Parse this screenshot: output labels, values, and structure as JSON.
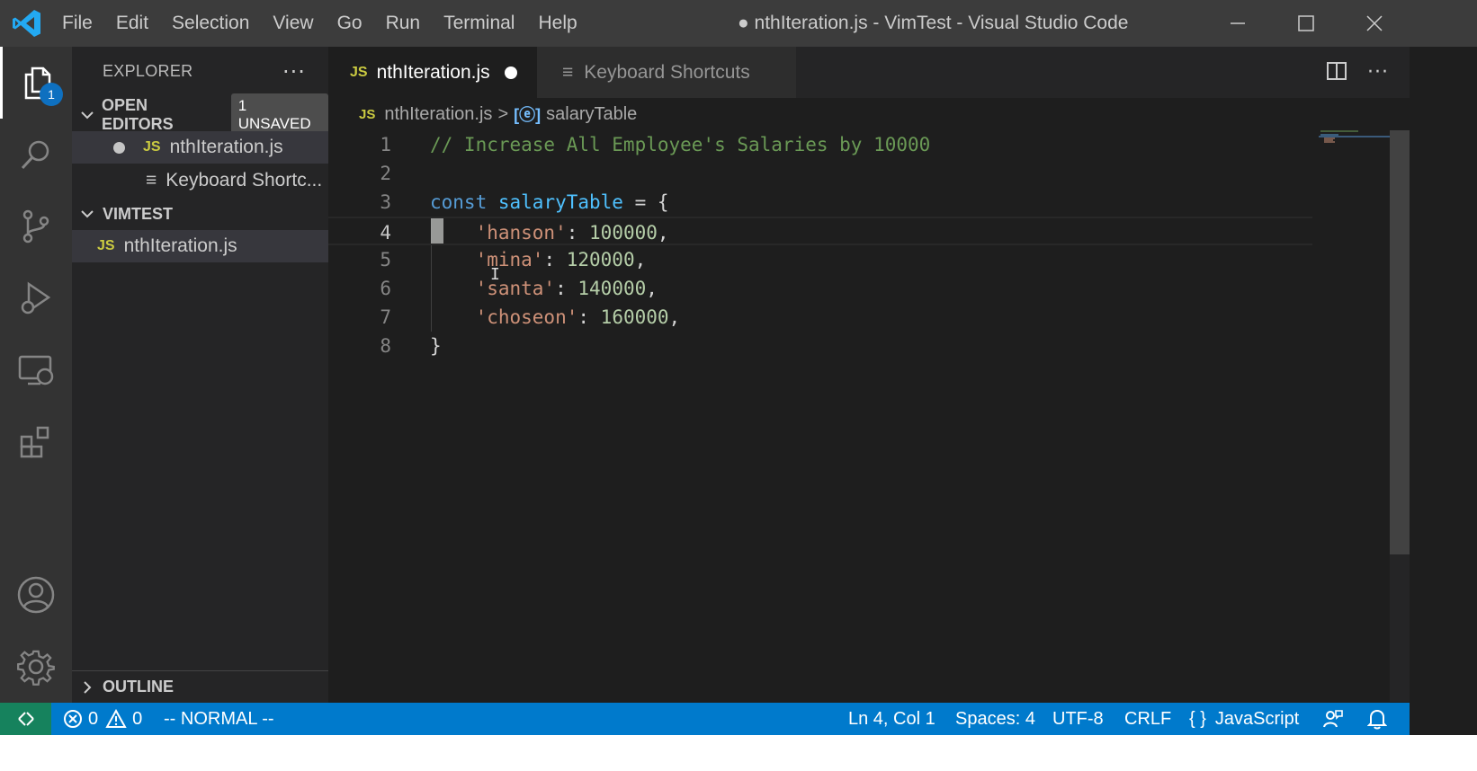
{
  "titlebar": {
    "menu": [
      "File",
      "Edit",
      "Selection",
      "View",
      "Go",
      "Run",
      "Terminal",
      "Help"
    ],
    "window_title": "● nthIteration.js - VimTest - Visual Studio Code"
  },
  "activitybar": {
    "explorer_badge": "1",
    "icons": [
      "files-icon",
      "search-icon",
      "source-control-icon",
      "run-debug-icon",
      "remote-explorer-icon",
      "extensions-icon",
      "accounts-icon",
      "settings-gear-icon"
    ]
  },
  "sidebar": {
    "title": "EXPLORER",
    "more": "···",
    "open_editors": {
      "label": "OPEN EDITORS",
      "badge": "1 UNSAVED",
      "items": [
        {
          "icon": "JS",
          "label": "nthIteration.js"
        },
        {
          "icon": "≡",
          "label": "Keyboard Shortc..."
        }
      ]
    },
    "workspace": {
      "label": "VIMTEST",
      "items": [
        {
          "icon": "JS",
          "label": "nthIteration.js"
        }
      ]
    },
    "outline_label": "OUTLINE"
  },
  "tabs": [
    {
      "icon": "JS",
      "label": "nthIteration.js",
      "active": true,
      "dirty": true
    },
    {
      "icon": "≡",
      "label": "Keyboard Shortcuts",
      "active": false
    }
  ],
  "breadcrumb": {
    "file_icon": "JS",
    "file": "nthIteration.js",
    "separator": ">",
    "symbol_icon": "[ⓔ]",
    "symbol": "salaryTable"
  },
  "editor": {
    "current_line": 4,
    "lines": [
      {
        "n": "1",
        "tokens": [
          {
            "t": "// Increase All Employee's Salaries by 10000",
            "c": "comment"
          }
        ]
      },
      {
        "n": "2",
        "tokens": []
      },
      {
        "n": "3",
        "tokens": [
          {
            "t": "const",
            "c": "keyword"
          },
          {
            "t": " ",
            "c": "punct"
          },
          {
            "t": "salaryTable",
            "c": "var"
          },
          {
            "t": " = {",
            "c": "punct"
          }
        ]
      },
      {
        "n": "4",
        "tokens": [
          {
            "t": "    ",
            "c": "punct"
          },
          {
            "t": "'hanson'",
            "c": "string"
          },
          {
            "t": ": ",
            "c": "punct"
          },
          {
            "t": "100000",
            "c": "number"
          },
          {
            "t": ",",
            "c": "punct"
          }
        ]
      },
      {
        "n": "5",
        "tokens": [
          {
            "t": "    ",
            "c": "punct"
          },
          {
            "t": "'mina'",
            "c": "string"
          },
          {
            "t": ": ",
            "c": "punct"
          },
          {
            "t": "120000",
            "c": "number"
          },
          {
            "t": ",",
            "c": "punct"
          }
        ]
      },
      {
        "n": "6",
        "tokens": [
          {
            "t": "    ",
            "c": "punct"
          },
          {
            "t": "'santa'",
            "c": "string"
          },
          {
            "t": ": ",
            "c": "punct"
          },
          {
            "t": "140000",
            "c": "number"
          },
          {
            "t": ",",
            "c": "punct"
          }
        ]
      },
      {
        "n": "7",
        "tokens": [
          {
            "t": "    ",
            "c": "punct"
          },
          {
            "t": "'choseon'",
            "c": "string"
          },
          {
            "t": ": ",
            "c": "punct"
          },
          {
            "t": "160000",
            "c": "number"
          },
          {
            "t": ",",
            "c": "punct"
          }
        ]
      },
      {
        "n": "8",
        "tokens": [
          {
            "t": "}",
            "c": "punct"
          }
        ]
      }
    ]
  },
  "statusbar": {
    "errors": "0",
    "warnings": "0",
    "mode": "-- NORMAL --",
    "position": "Ln 4, Col 1",
    "spaces": "Spaces: 4",
    "encoding": "UTF-8",
    "eol": "CRLF",
    "language_icon": "{ }",
    "language": "JavaScript"
  },
  "colors": {
    "accent": "#007acc",
    "remote": "#16825d",
    "js_icon": "#cbcb41"
  }
}
